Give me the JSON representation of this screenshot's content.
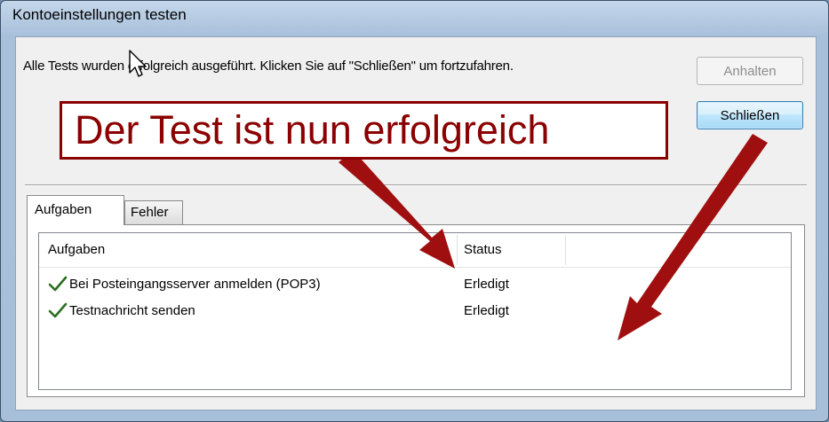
{
  "window": {
    "title": "Kontoeinstellungen testen"
  },
  "message": "Alle Tests wurden erfolgreich ausgeführt. Klicken Sie auf \"Schließen\" um fortzufahren.",
  "buttons": {
    "stop_label": "Anhalten",
    "close_label": "Schließen"
  },
  "tabs": [
    {
      "label": "Aufgaben",
      "active": true
    },
    {
      "label": "Fehler",
      "active": false
    }
  ],
  "table": {
    "columns": [
      "Aufgaben",
      "Status"
    ],
    "rows": [
      {
        "icon": "checkmark-icon",
        "task": "Bei Posteingangsserver anmelden (POP3)",
        "status": "Erledigt"
      },
      {
        "icon": "checkmark-icon",
        "task": "Testnachricht senden",
        "status": "Erledigt"
      }
    ]
  },
  "annotation": {
    "text": "Der Test ist nun erfolgreich",
    "color": "#8b0000"
  },
  "colors": {
    "check": "#2a6e1e",
    "arrow": "#a00f0f"
  }
}
